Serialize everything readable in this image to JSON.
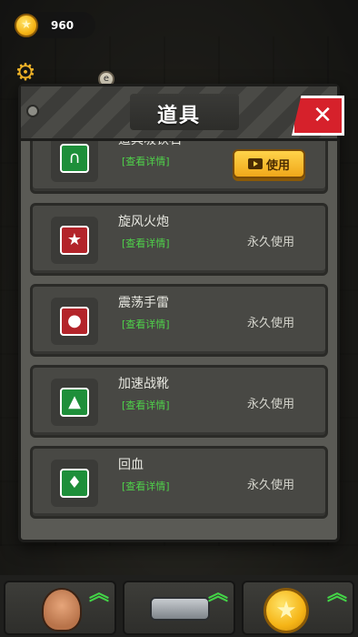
{
  "hud": {
    "coins": "960",
    "coin_icon": "star-coin-icon",
    "settings_icon": "gear-icon"
  },
  "modal": {
    "title": "道具",
    "close_label": "✕",
    "items": [
      {
        "name": "道具吸铁石",
        "detail_label": "[查看详情]",
        "action_label": "使用",
        "action_type": "button",
        "icon": "magnet-icon",
        "icon_color": "#1e8f3a"
      },
      {
        "name": "旋风火炮",
        "detail_label": "[查看详情]",
        "action_label": "永久使用",
        "action_type": "status",
        "icon": "shield-star-icon",
        "icon_color": "#b3242a"
      },
      {
        "name": "震荡手雷",
        "detail_label": "[查看详情]",
        "action_label": "永久使用",
        "action_type": "status",
        "icon": "grenade-icon",
        "icon_color": "#b3242a"
      },
      {
        "name": "加速战靴",
        "detail_label": "[查看详情]",
        "action_label": "永久使用",
        "action_type": "status",
        "icon": "boot-icon",
        "icon_color": "#1e8f3a"
      },
      {
        "name": "回血",
        "detail_label": "[查看详情]",
        "action_label": "永久使用",
        "action_type": "status",
        "icon": "blood-drop-icon",
        "icon_color": "#1e8f3a"
      }
    ]
  },
  "bottom_bar": {
    "slots": [
      {
        "icon": "character-portrait-icon",
        "upgrade_icon": "upgrade-arrows-icon"
      },
      {
        "icon": "revolver-icon",
        "upgrade_icon": "upgrade-arrows-icon"
      },
      {
        "icon": "star-coin-icon",
        "upgrade_icon": "upgrade-arrows-icon"
      }
    ]
  },
  "colors": {
    "accent_gold": "#f5b416",
    "detail_green": "#4fd24a",
    "close_red": "#d6212b",
    "upgrade_green": "#43d647"
  }
}
